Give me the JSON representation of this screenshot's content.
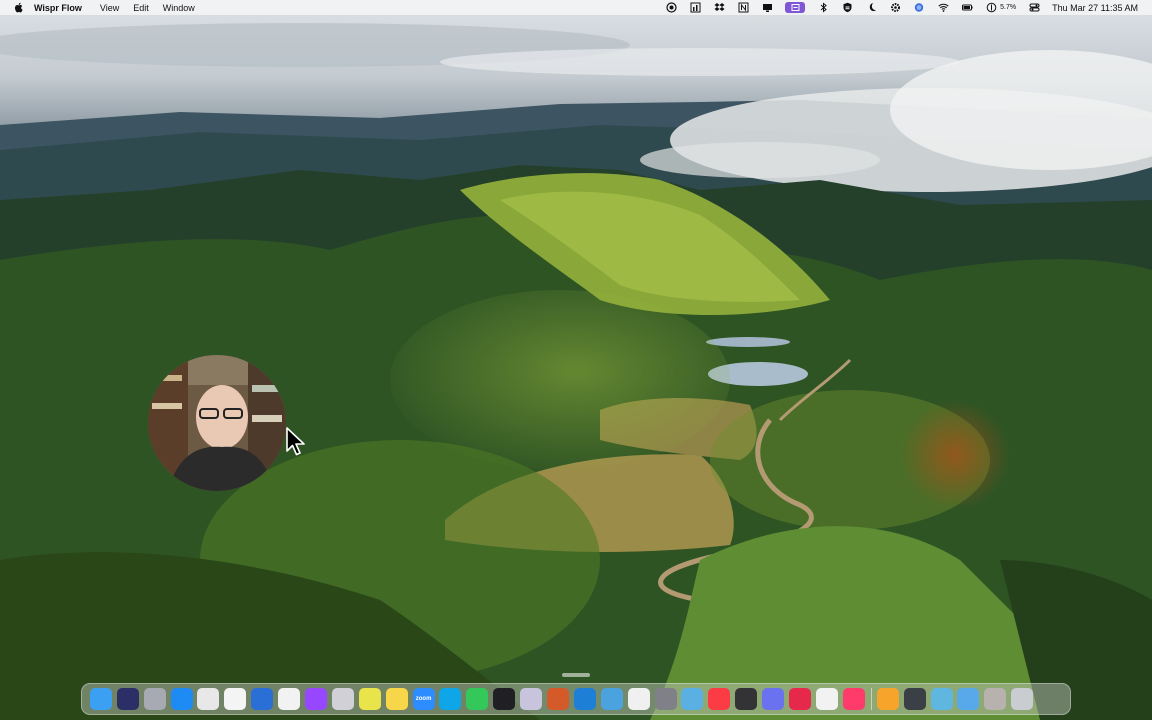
{
  "menubar": {
    "app_name": "Wispr Flow",
    "menus": [
      "View",
      "Edit",
      "Window"
    ],
    "battery_text": "5.7%",
    "clock": "Thu Mar 27  11:35 AM"
  },
  "status_icons": [
    "screen-record-icon",
    "memory-monitor-icon",
    "dropbox-icon",
    "notion-icon",
    "display-icon",
    "wispr-flow-active-icon",
    "bluetooth-icon",
    "shield-icon",
    "moon-icon",
    "gear-icon",
    "siri-icon",
    "wifi-icon",
    "battery-icon",
    "battery-percent-icon",
    "control-center-icon"
  ],
  "dock": {
    "zoom_label": "zoom",
    "items": [
      {
        "name": "finder-icon",
        "color": "#3ba0f2"
      },
      {
        "name": "siri-app-icon",
        "color": "#2b2f66"
      },
      {
        "name": "launchpad-icon",
        "color": "#a7aab3"
      },
      {
        "name": "app-store-icon",
        "color": "#1e8bf5"
      },
      {
        "name": "chrome-icon",
        "color": "#e8e8e8"
      },
      {
        "name": "notion-app-icon",
        "color": "#f4f4f4"
      },
      {
        "name": "screenshot-app-icon",
        "color": "#2a6fd6"
      },
      {
        "name": "reminders-icon",
        "color": "#f2f2f2"
      },
      {
        "name": "figma-icon",
        "color": "#9747ff"
      },
      {
        "name": "script-editor-icon",
        "color": "#d0d0d6"
      },
      {
        "name": "tempo-icon",
        "color": "#e9e44a"
      },
      {
        "name": "notes-icon",
        "color": "#f8d64a"
      },
      {
        "name": "zoom-icon",
        "color": "#2d8cff"
      },
      {
        "name": "skype-icon",
        "color": "#0ea5e9"
      },
      {
        "name": "messages-icon",
        "color": "#34c759"
      },
      {
        "name": "scissors-icon",
        "color": "#1f1f24"
      },
      {
        "name": "bbedit-icon",
        "color": "#c9c4dd"
      },
      {
        "name": "claude-icon",
        "color": "#d45a2a"
      },
      {
        "name": "vscode-icon",
        "color": "#1d7fd6"
      },
      {
        "name": "cloud-icon",
        "color": "#4aa3df"
      },
      {
        "name": "photos-icon",
        "color": "#f0f0f0"
      },
      {
        "name": "shield-app-icon",
        "color": "#808089"
      },
      {
        "name": "maps-icon",
        "color": "#5bb0e3"
      },
      {
        "name": "music-icon",
        "color": "#fc3c44"
      },
      {
        "name": "calculator-icon",
        "color": "#333336"
      },
      {
        "name": "settings-app-icon",
        "color": "#6a72f0"
      },
      {
        "name": "plane-icon",
        "color": "#e6294a"
      },
      {
        "name": "chatgpt-icon",
        "color": "#f2f2f2"
      },
      {
        "name": "target-icon",
        "color": "#ff3b6b"
      },
      {
        "name": "separator"
      },
      {
        "name": "folder-orange-icon",
        "color": "#f7a42a"
      },
      {
        "name": "stats-app-icon",
        "color": "#3b3f46"
      },
      {
        "name": "preview-icon",
        "color": "#5fb7e0"
      },
      {
        "name": "downloads-folder-icon",
        "color": "#57a9e9"
      },
      {
        "name": "archive-icon",
        "color": "#b7b2ad"
      },
      {
        "name": "trash-icon",
        "color": "#c9ccd0"
      }
    ]
  }
}
